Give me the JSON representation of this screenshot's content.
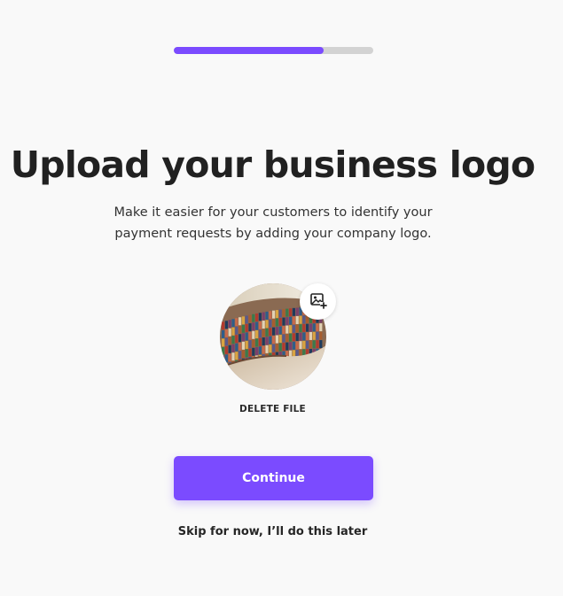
{
  "progress": {
    "value_percent": 75,
    "fill_color": "#7b4bff",
    "track_color": "#d3d3d3"
  },
  "header": {
    "title": "Upload your business logo",
    "subtitle": "Make it easier for your customers to identify your payment requests by adding your company logo."
  },
  "logo": {
    "image_icon": "image-plus-icon",
    "delete_label": "DELETE FILE"
  },
  "actions": {
    "continue_label": "Continue",
    "skip_label": "Skip for now, I’ll do this later"
  },
  "colors": {
    "accent": "#7b4bff",
    "background": "#f9f9f9"
  }
}
